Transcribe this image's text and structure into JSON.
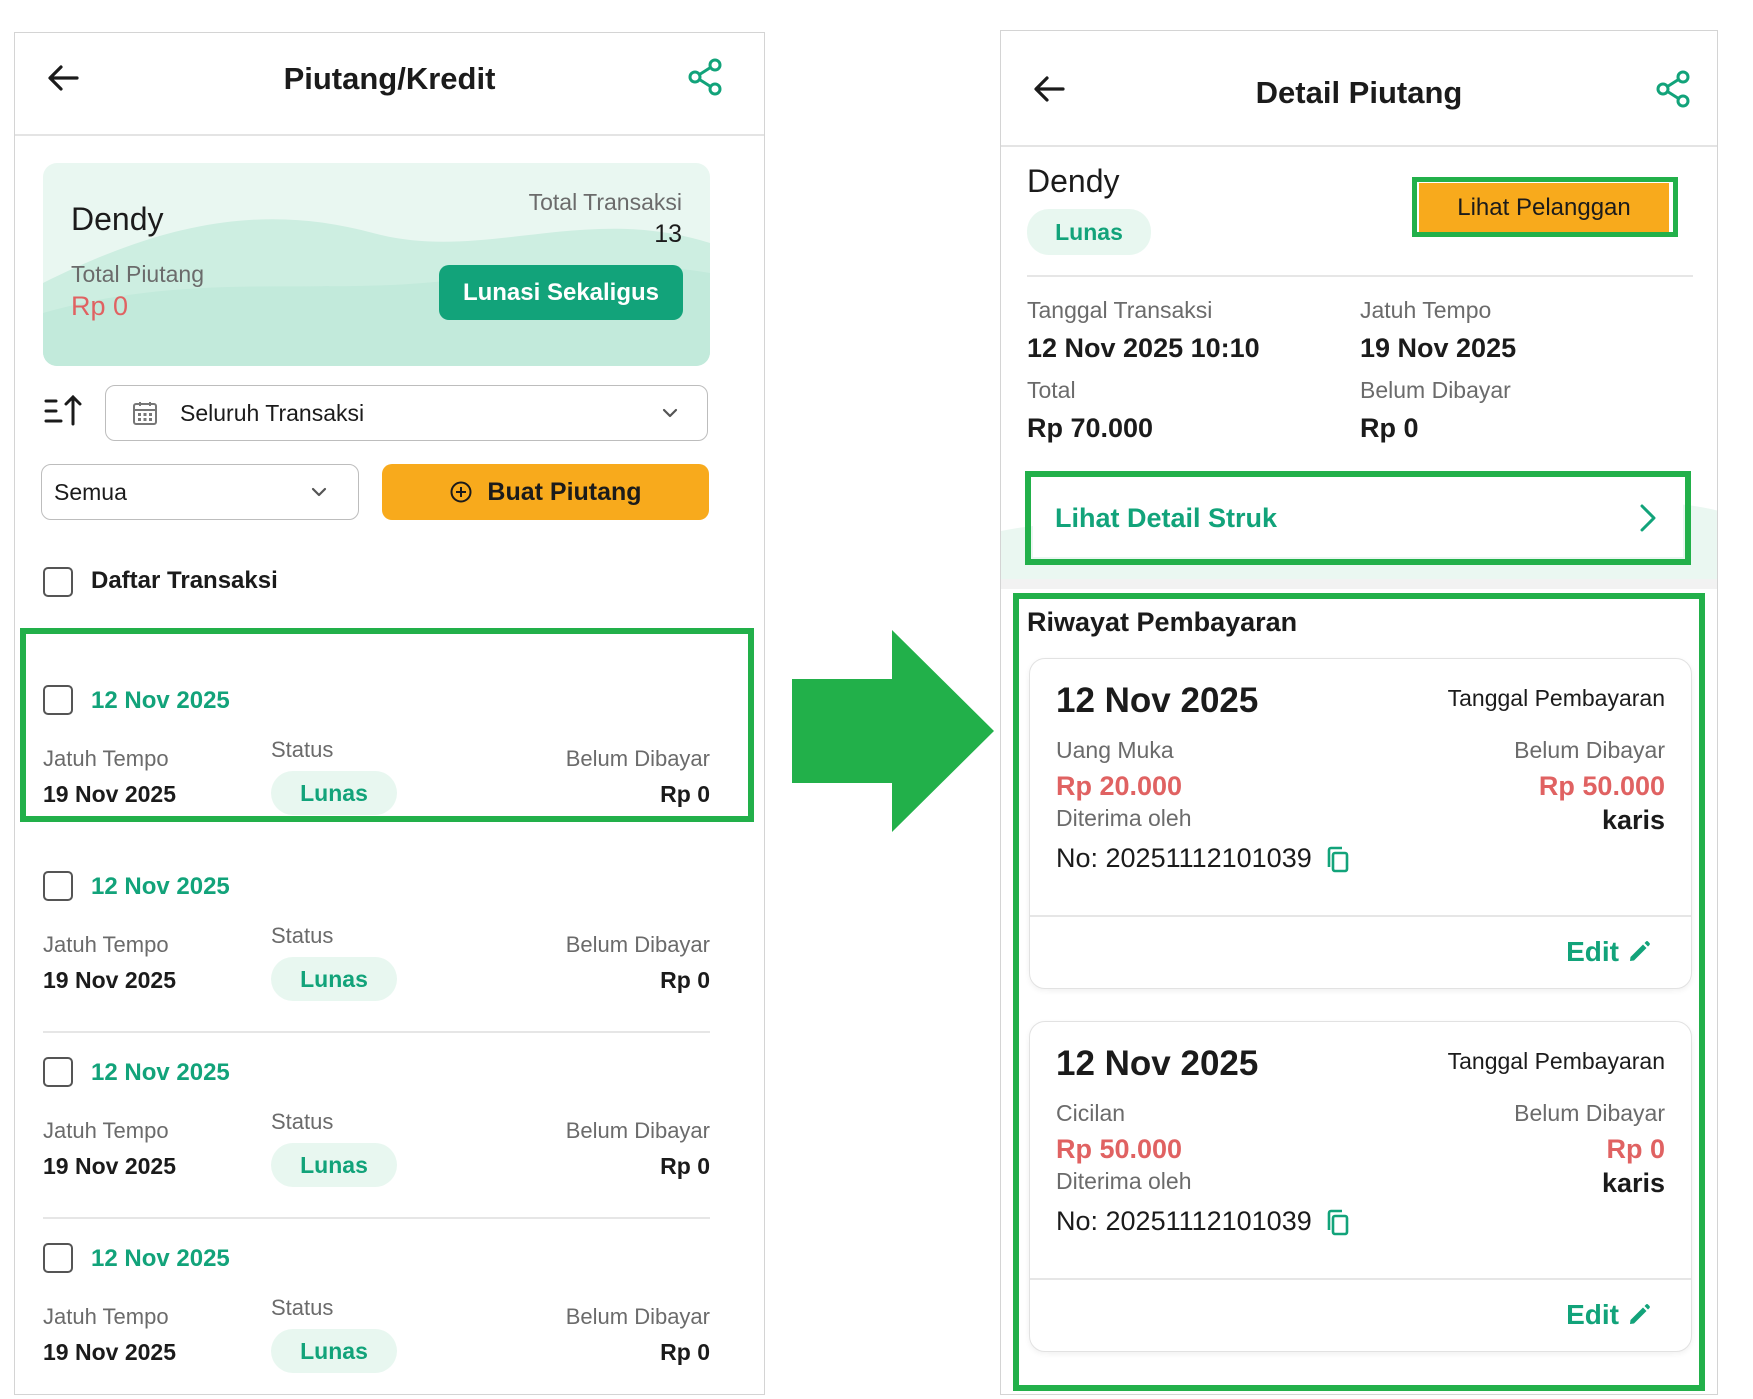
{
  "colors": {
    "accent_green": "#12a37a",
    "accent_orange": "#f8aa1c",
    "highlight_green": "#22b04a",
    "red_amount": "#e06262"
  },
  "left": {
    "header": {
      "title": "Piutang/Kredit",
      "back_icon": "arrow-left-icon",
      "share_icon": "share-icon"
    },
    "summary": {
      "customer_name": "Dendy",
      "total_transaksi_label": "Total Transaksi",
      "total_transaksi_value": "13",
      "total_piutang_label": "Total Piutang",
      "total_piutang_value": "Rp 0",
      "lunasi_button": "Lunasi Sekaligus"
    },
    "filters": {
      "sort_icon": "sort-icon",
      "calendar_icon": "calendar-icon",
      "period_select": "Seluruh Transaksi",
      "status_select": "Semua",
      "buat_button": "Buat Piutang",
      "buat_icon": "plus-circle-icon"
    },
    "list_header": "Daftar Transaksi",
    "transactions": [
      {
        "date": "12 Nov 2025",
        "jatuh_tempo_label": "Jatuh Tempo",
        "jatuh_tempo": "19 Nov 2025",
        "status_label": "Status",
        "status": "Lunas",
        "belum_label": "Belum Dibayar",
        "belum": "Rp 0"
      },
      {
        "date": "12 Nov 2025",
        "jatuh_tempo_label": "Jatuh Tempo",
        "jatuh_tempo": "19 Nov 2025",
        "status_label": "Status",
        "status": "Lunas",
        "belum_label": "Belum Dibayar",
        "belum": "Rp 0"
      },
      {
        "date": "12 Nov 2025",
        "jatuh_tempo_label": "Jatuh Tempo",
        "jatuh_tempo": "19 Nov 2025",
        "status_label": "Status",
        "status": "Lunas",
        "belum_label": "Belum Dibayar",
        "belum": "Rp 0"
      },
      {
        "date": "12 Nov 2025",
        "jatuh_tempo_label": "Jatuh Tempo",
        "jatuh_tempo": "19 Nov 2025",
        "status_label": "Status",
        "status": "Lunas",
        "belum_label": "Belum Dibayar",
        "belum": "Rp 0"
      }
    ]
  },
  "right": {
    "header": {
      "title": "Detail Piutang",
      "back_icon": "arrow-left-icon",
      "share_icon": "share-icon"
    },
    "customer": {
      "name": "Dendy",
      "status": "Lunas",
      "lihat_button": "Lihat Pelanggan"
    },
    "info": {
      "tanggal_label": "Tanggal Transaksi",
      "tanggal_value": "12 Nov 2025 10:10",
      "jatuh_label": "Jatuh Tempo",
      "jatuh_value": "19 Nov 2025",
      "total_label": "Total",
      "total_value": "Rp 70.000",
      "belum_label": "Belum Dibayar",
      "belum_value": "Rp 0"
    },
    "struk_link": "Lihat Detail Struk",
    "riwayat_title": "Riwayat Pembayaran",
    "payments": [
      {
        "date": "12 Nov 2025",
        "tanggal_label": "Tanggal Pembayaran",
        "type": "Uang Muka",
        "amount": "Rp 20.000",
        "belum_label": "Belum Dibayar",
        "belum": "Rp 50.000",
        "diterima_label": "Diterima oleh",
        "receiver": "karis",
        "no": "No: 20251112101039",
        "edit": "Edit"
      },
      {
        "date": "12 Nov 2025",
        "tanggal_label": "Tanggal Pembayaran",
        "type": "Cicilan",
        "amount": "Rp 50.000",
        "belum_label": "Belum Dibayar",
        "belum": "Rp 0",
        "diterima_label": "Diterima oleh",
        "receiver": "karis",
        "no": "No: 20251112101039",
        "edit": "Edit"
      }
    ]
  }
}
